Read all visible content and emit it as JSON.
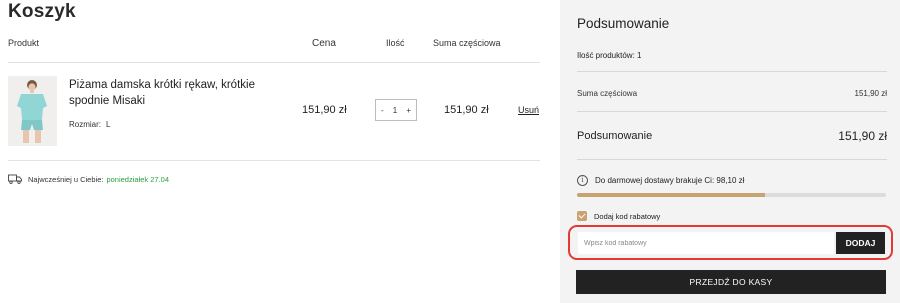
{
  "page": {
    "title": "Koszyk"
  },
  "table": {
    "headers": {
      "product": "Produkt",
      "price": "Cena",
      "quantity": "Ilość",
      "subtotal": "Suma częściowa"
    },
    "rows": [
      {
        "name": "Piżama damska krótki rękaw, krótkie spodnie Misaki",
        "attr_label": "Rozmiar:",
        "attr_value": "L",
        "price": "151,90 zł",
        "qty_minus": "-",
        "qty": "1",
        "qty_plus": "+",
        "subtotal": "151,90 zł",
        "remove_label": "Usuń"
      }
    ]
  },
  "delivery": {
    "text": "Najwcześniej u Ciebie:",
    "date": "poniedziałek 27.04"
  },
  "summary": {
    "title": "Podsumowanie",
    "count_text": "Ilość produktów: 1",
    "subtotal_label": "Suma częściowa",
    "subtotal_value": "151,90 zł",
    "total_label": "Podsumowanie",
    "total_value": "151,90 zł",
    "free_shipping_text": "Do darmowej dostawy brakuje Ci: 98,10 zł",
    "free_shipping_progress": 0.61,
    "coupon_toggle_label": "Dodaj kod rabatowy",
    "coupon_placeholder": "Wpisz kod rabatowy",
    "coupon_button": "DODAJ",
    "checkout_button": "PRZEJDŹ DO KASY"
  },
  "colors": {
    "accent_gold": "#c9a272",
    "delivery_green": "#2e9e46",
    "highlight_red": "#e53935",
    "button_dark": "#222222"
  },
  "icons": {
    "delivery": "truck-icon",
    "info": "info-icon",
    "checkbox": "checkbox-checked-icon"
  }
}
